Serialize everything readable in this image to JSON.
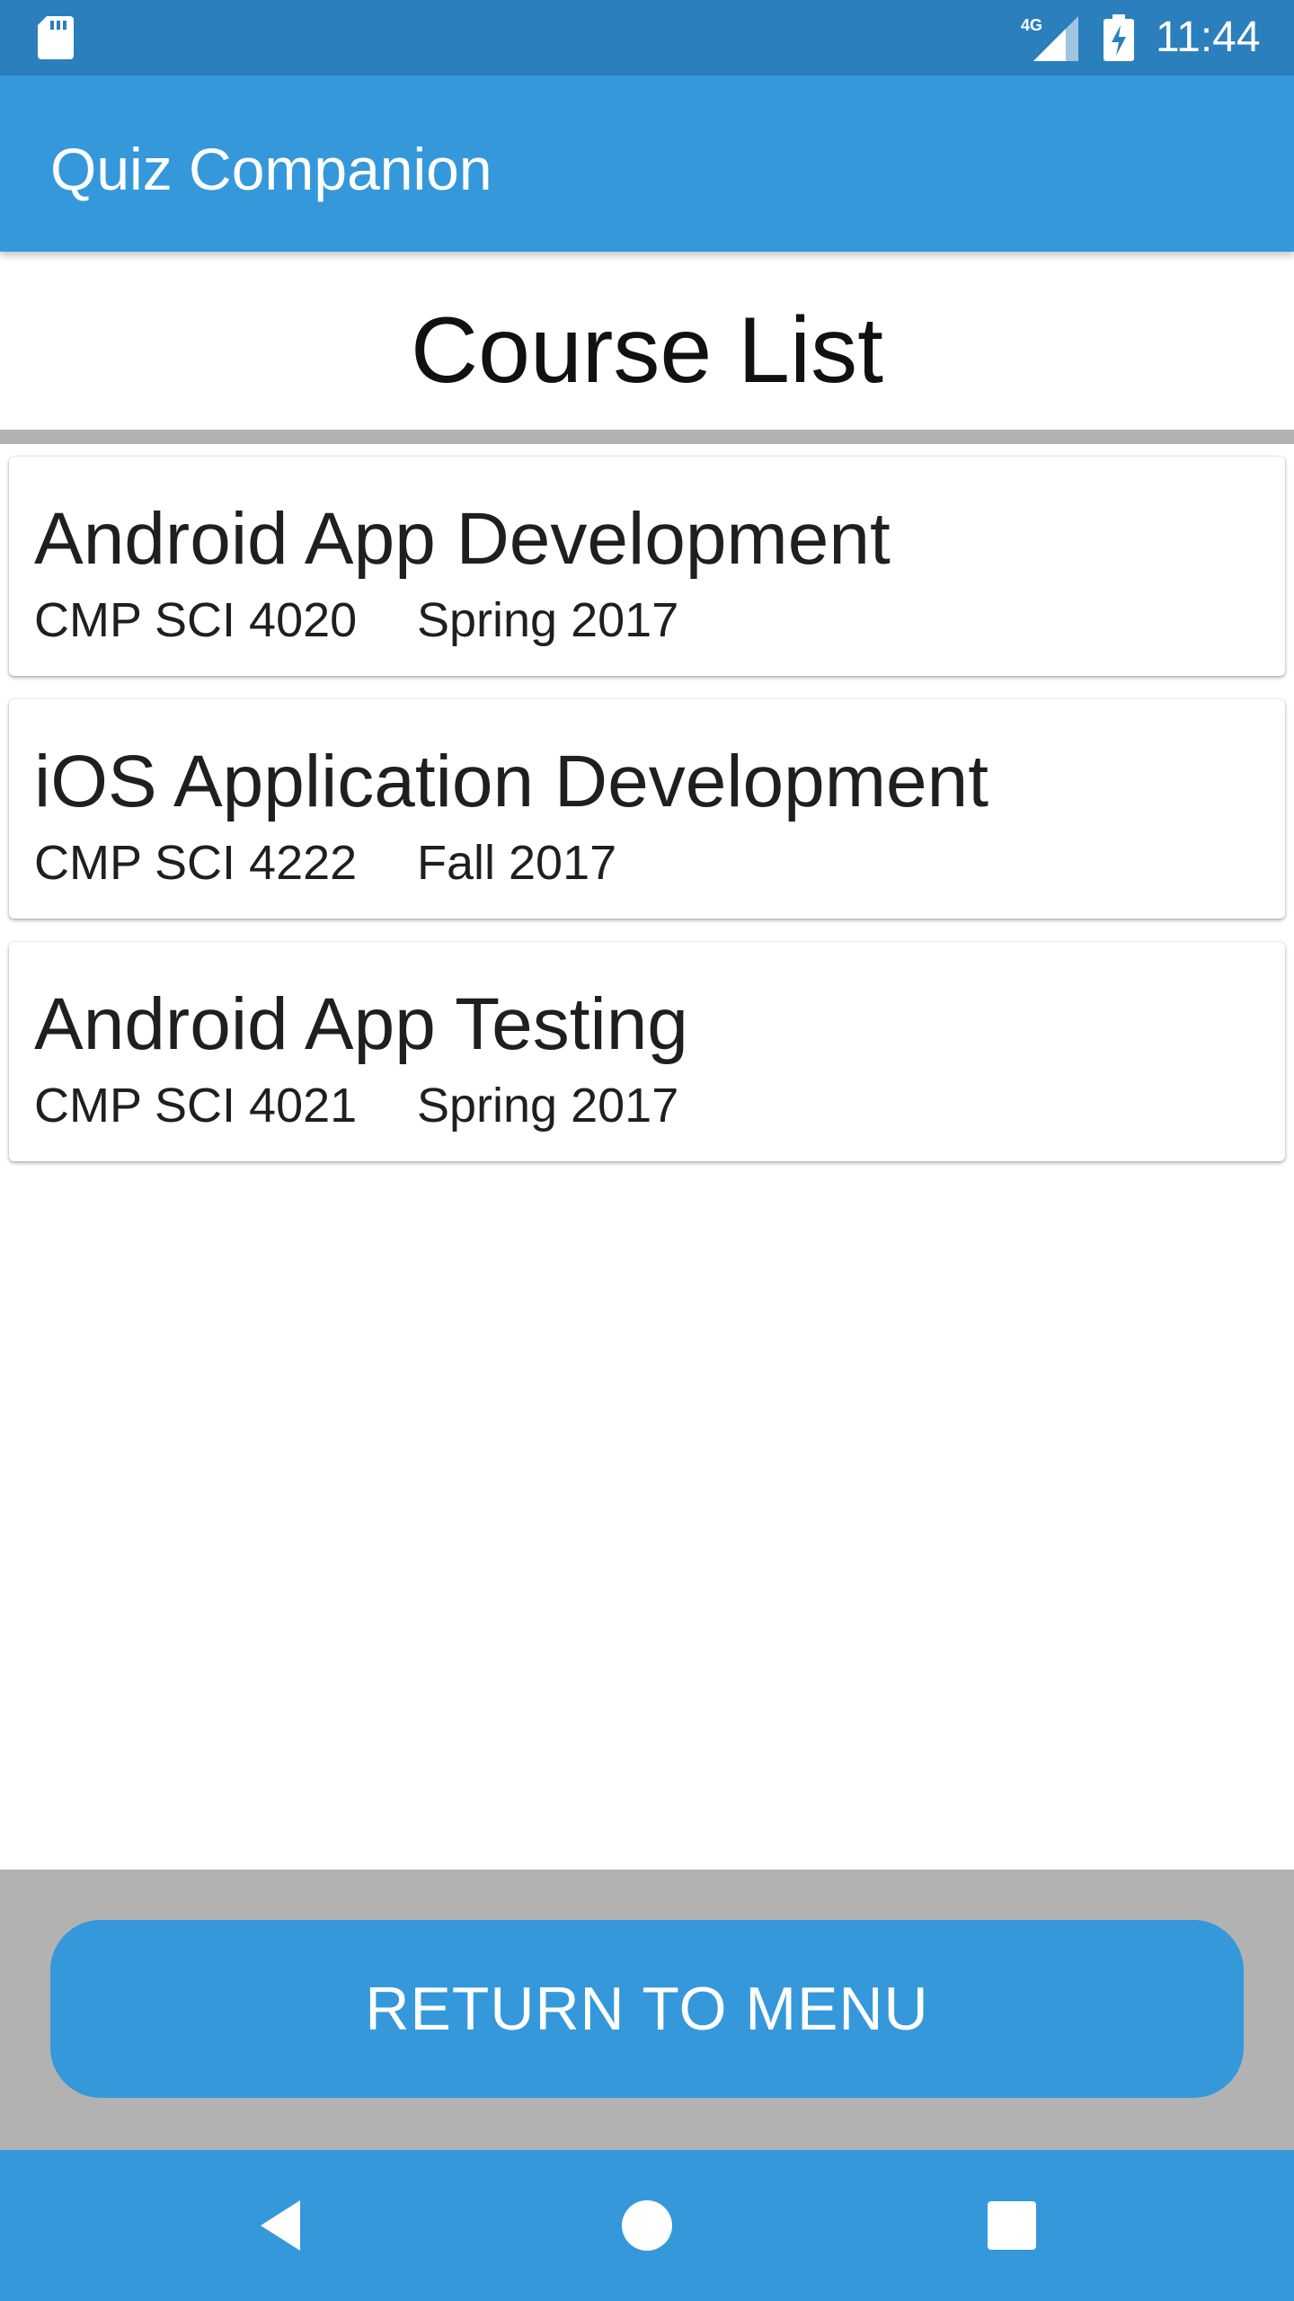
{
  "status_bar": {
    "time": "11:44",
    "network": "4G",
    "icons": [
      "sd-card-icon",
      "signal-4g-icon",
      "battery-charging-icon"
    ]
  },
  "app_bar": {
    "title": "Quiz Companion"
  },
  "page": {
    "title": "Course List"
  },
  "courses": [
    {
      "title": "Android App Development",
      "code": "CMP SCI 4020",
      "term": "Spring 2017"
    },
    {
      "title": "iOS Application Development",
      "code": "CMP SCI 4222",
      "term": "Fall 2017"
    },
    {
      "title": "Android App Testing",
      "code": "CMP SCI 4021",
      "term": "Spring 2017"
    }
  ],
  "footer": {
    "return_label": "RETURN TO MENU"
  },
  "nav_bar": {
    "icons": [
      "back-icon",
      "home-icon",
      "recents-icon"
    ]
  },
  "colors": {
    "primary": "#3598db",
    "primary_dark": "#2b7fbd",
    "footer_gray": "#b2b2b2"
  }
}
